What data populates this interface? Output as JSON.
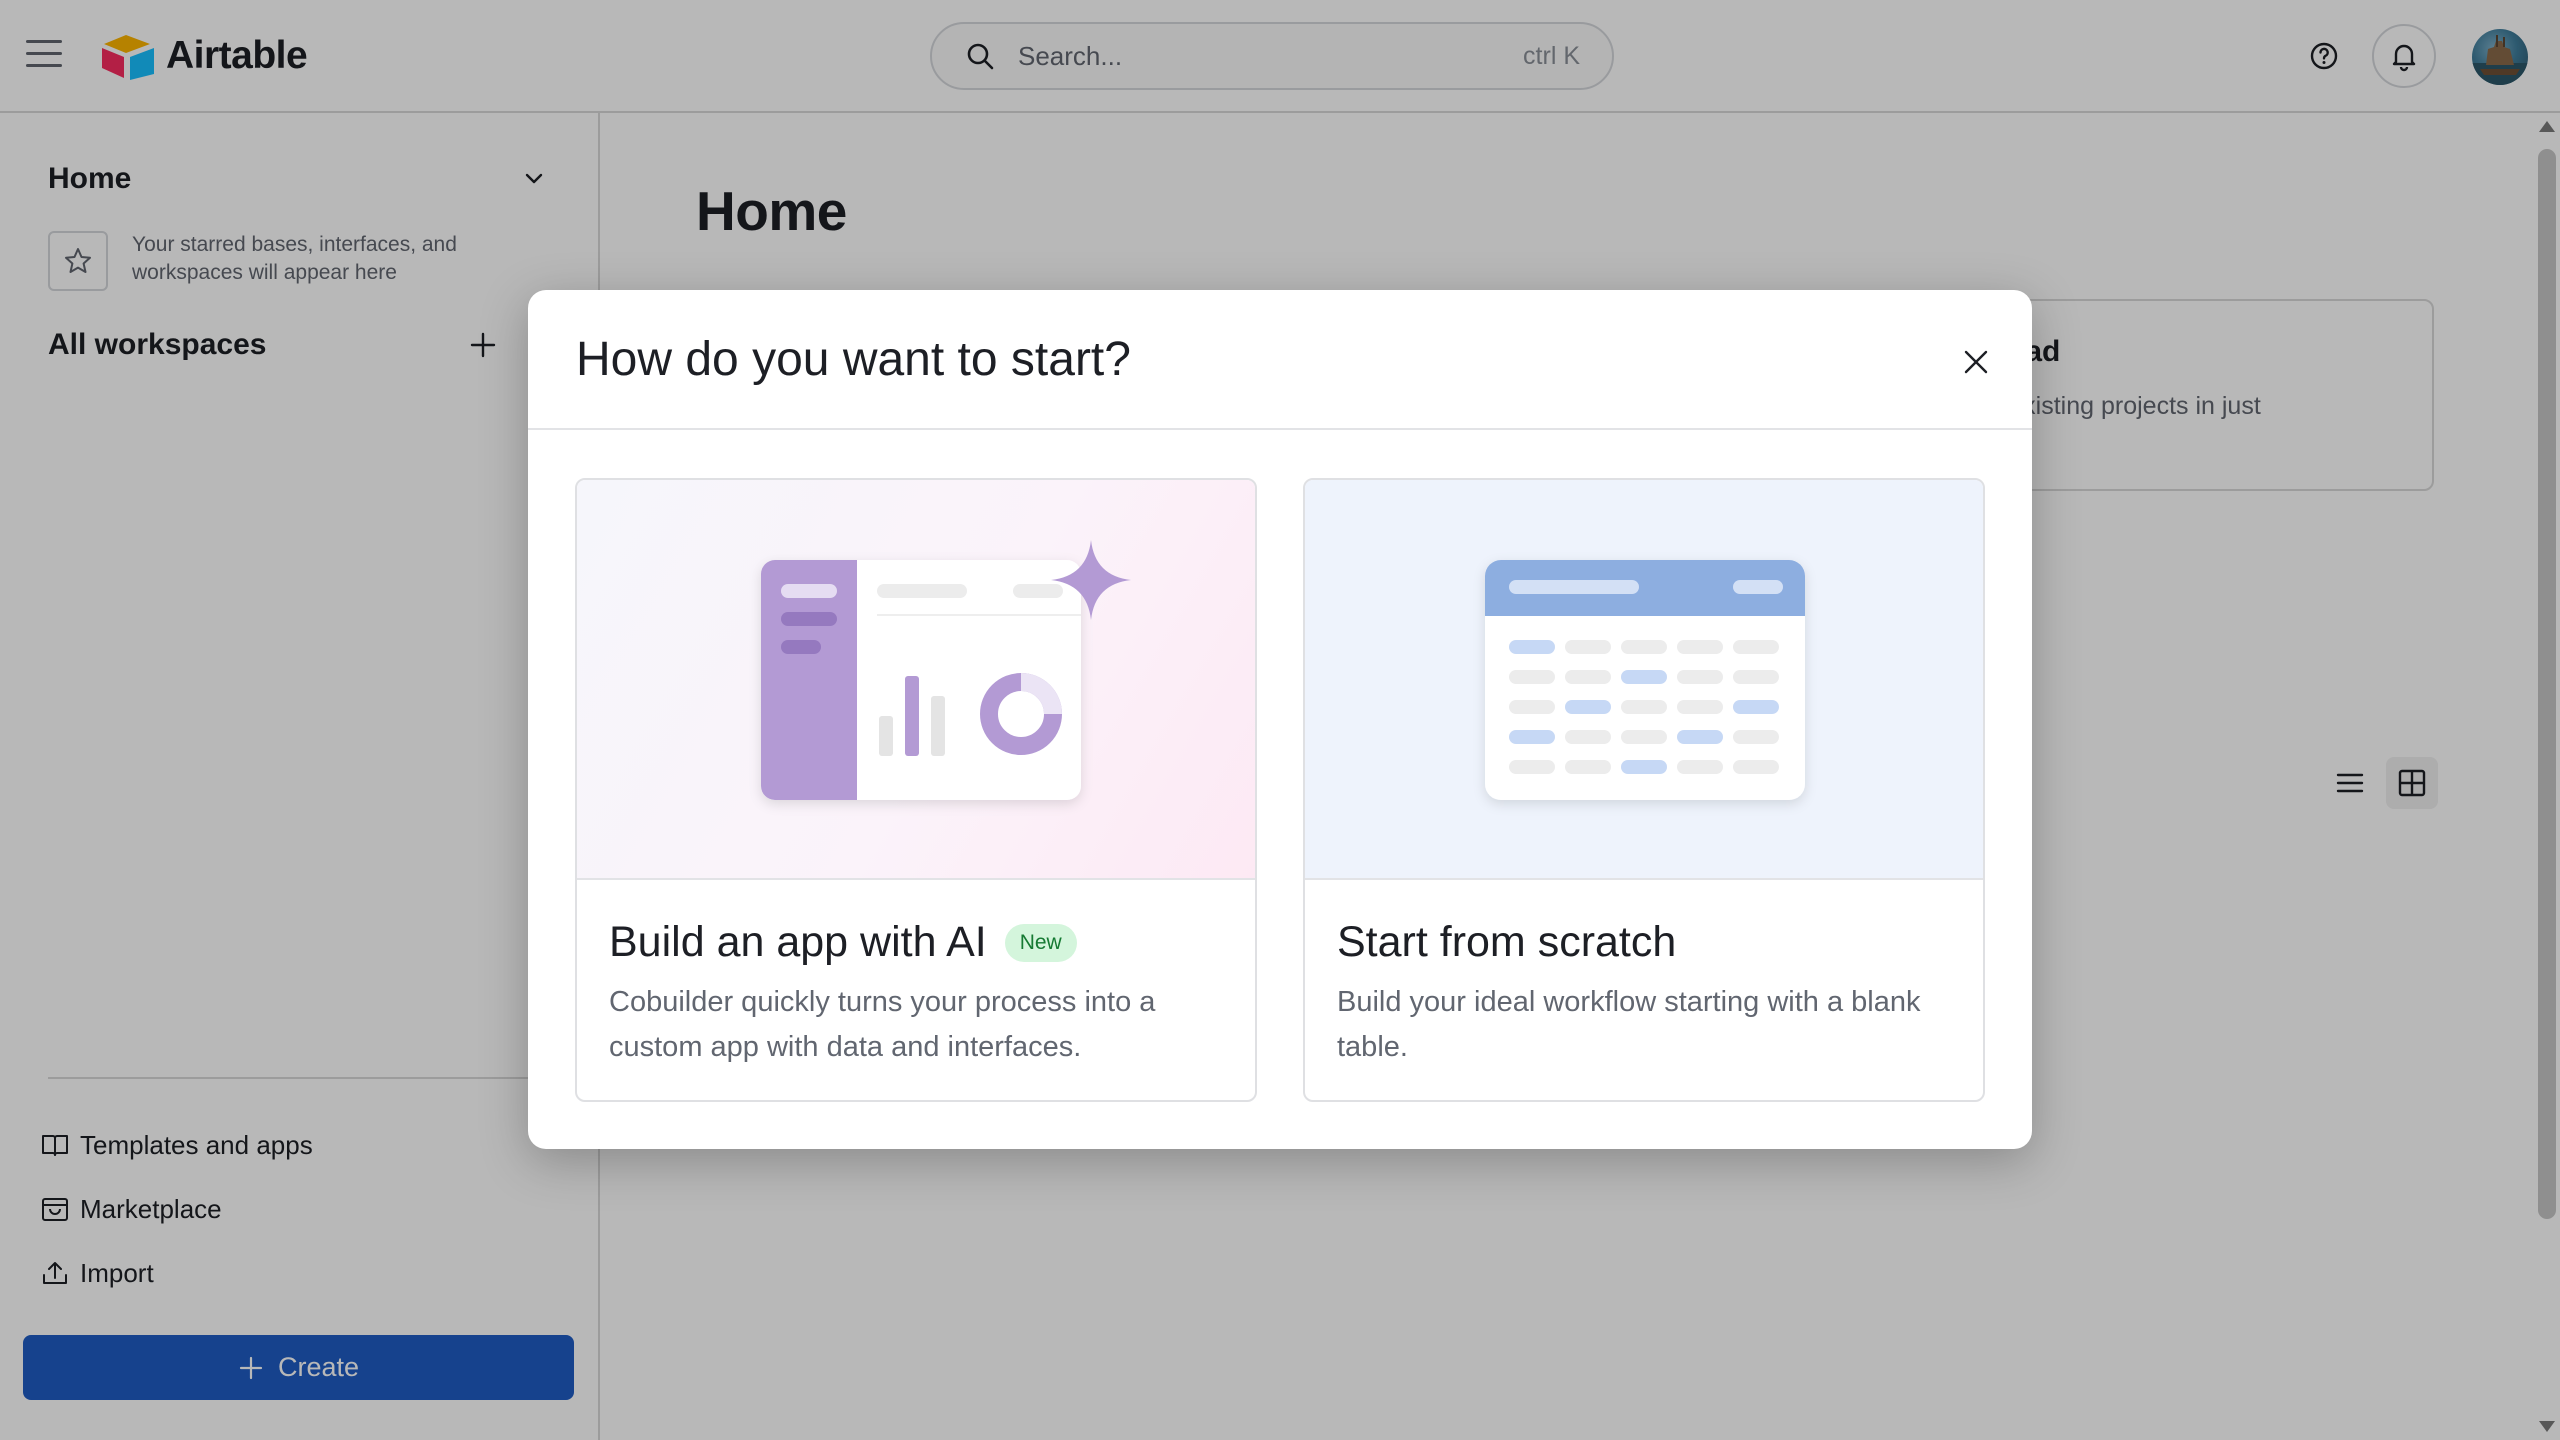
{
  "header": {
    "brand": "Airtable",
    "search_placeholder": "Search...",
    "search_shortcut": "ctrl K",
    "icons": [
      "menu-icon",
      "airtable-logo",
      "search-icon",
      "help-icon",
      "bell-icon",
      "avatar"
    ]
  },
  "sidebar": {
    "home_title": "Home",
    "starred_hint": "Your starred bases, interfaces, and workspaces will appear here",
    "workspaces_title": "All workspaces",
    "links": {
      "templates": "Templates and apps",
      "marketplace": "Marketplace",
      "import": "Import"
    },
    "create_label": "Create"
  },
  "main": {
    "title": "Home",
    "upload_card": {
      "title": "kly upload",
      "description": "ate your existing projects in just\ntes."
    },
    "view_options": [
      "list-view",
      "grid-view"
    ],
    "active_view": "grid-view"
  },
  "modal": {
    "title": "How do you want to start?",
    "options": [
      {
        "title": "Build an app with AI",
        "badge": "New",
        "description": "Cobuilder quickly turns your process into a custom app with data and interfaces."
      },
      {
        "title": "Start from scratch",
        "description": "Build your ideal workflow starting with a blank table."
      }
    ]
  },
  "colors": {
    "primary_button": "#1f5cc4",
    "badge_bg": "#d4f5dc",
    "badge_text": "#167a33",
    "ai_purple": "#b39ad4",
    "table_header_blue": "#8daee0"
  }
}
